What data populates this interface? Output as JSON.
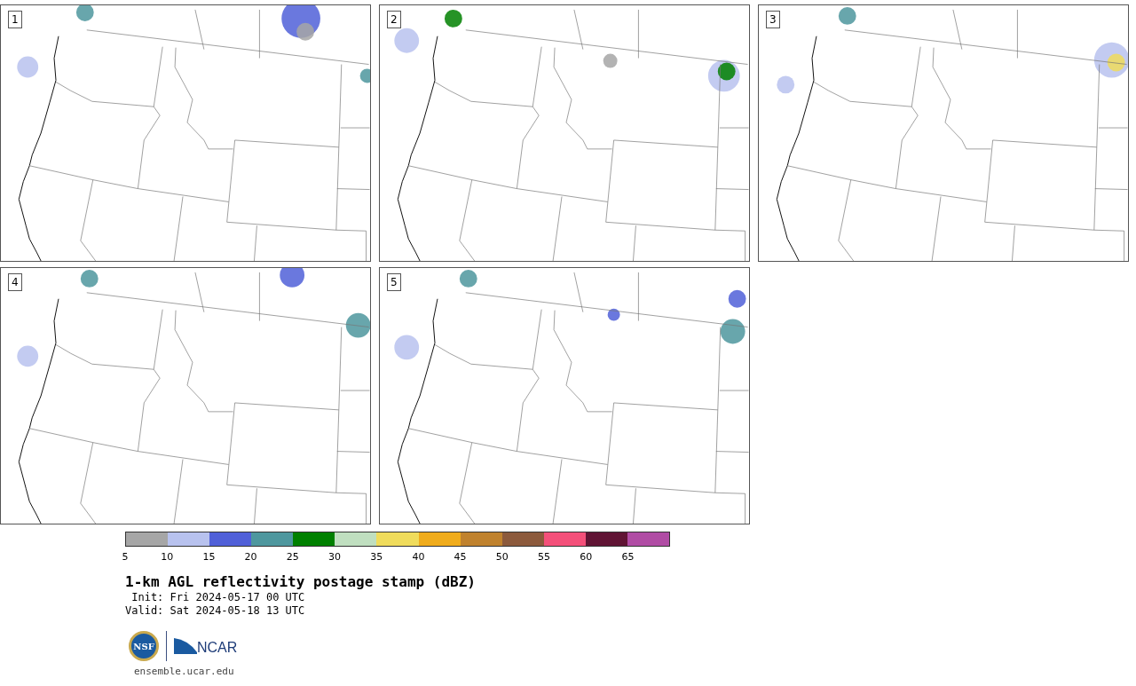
{
  "panels": [
    {
      "label": "1"
    },
    {
      "label": "2"
    },
    {
      "label": "3"
    },
    {
      "label": "4"
    },
    {
      "label": "5"
    }
  ],
  "colorbar": {
    "segments": [
      {
        "color": "#a6a6a6",
        "tick": "5"
      },
      {
        "color": "#b8c2ee",
        "tick": "10"
      },
      {
        "color": "#5060d8",
        "tick": "15"
      },
      {
        "color": "#4e979e",
        "tick": "20"
      },
      {
        "color": "#008000",
        "tick": "25"
      },
      {
        "color": "#c0dfc0",
        "tick": "30"
      },
      {
        "color": "#f0dc5c",
        "tick": "35"
      },
      {
        "color": "#f0ac1c",
        "tick": "40"
      },
      {
        "color": "#c0822e",
        "tick": "45"
      },
      {
        "color": "#8c5a3c",
        "tick": "50"
      },
      {
        "color": "#f4507a",
        "tick": "55"
      },
      {
        "color": "#601434",
        "tick": "60"
      },
      {
        "color": "#b04ca4",
        "tick": "65"
      }
    ]
  },
  "title": "1-km AGL reflectivity postage stamp (dBZ)",
  "init": " Init: Fri 2024-05-17 00 UTC",
  "valid": "Valid: Sat 2024-05-18 13 UTC",
  "logos": {
    "nsf": "NSF",
    "ncar": "NCAR"
  },
  "url": "ensemble.ucar.edu"
}
